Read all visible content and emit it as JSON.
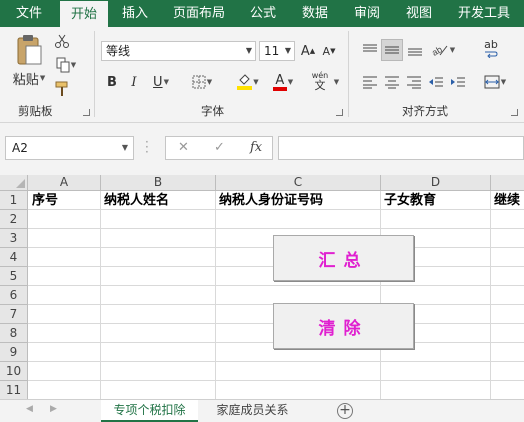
{
  "ribbon_tabs": [
    "文件",
    "开始",
    "插入",
    "页面布局",
    "公式",
    "数据",
    "审阅",
    "视图",
    "开发工具"
  ],
  "active_tab": "开始",
  "clipboard": {
    "paste_label": "粘贴",
    "group_label": "剪贴板",
    "icons": [
      "paste-icon",
      "cut-icon",
      "copy-icon",
      "format-painter-icon"
    ]
  },
  "font": {
    "font_name": "等线",
    "font_size": "11",
    "bold": "B",
    "italic": "I",
    "underline": "U",
    "font_color_glyph": "A",
    "fill_color": "#ffe100",
    "font_color": "#e00000",
    "pinyin_top": "wén",
    "pinyin_bottom": "文",
    "group_label": "字体"
  },
  "alignment": {
    "group_label": "对齐方式",
    "wrap_glyph": "ab",
    "icons": [
      "align-top-icon",
      "align-middle-icon",
      "align-bottom-icon",
      "orientation-icon",
      "align-left-icon",
      "align-center-icon",
      "align-right-icon",
      "decrease-indent-icon",
      "increase-indent-icon",
      "wrap-text-icon",
      "merge-center-icon"
    ]
  },
  "formula_bar": {
    "name_box": "A2",
    "cancel_glyph": "✕",
    "enter_glyph": "✓",
    "fx_label": "fx",
    "formula": ""
  },
  "columns": [
    "A",
    "B",
    "C",
    "D"
  ],
  "rows": [
    "1",
    "2",
    "3",
    "4",
    "5",
    "6",
    "7",
    "8",
    "9",
    "10",
    "11"
  ],
  "header_row": [
    "序号",
    "纳税人姓名",
    "纳税人身份证号码",
    "子女教育",
    "继续"
  ],
  "buttons": {
    "summary": "汇总",
    "clear": "清除",
    "text_color": "#e020d0"
  },
  "sheet_tabs": [
    "专项个税扣除",
    "家庭成员关系"
  ],
  "active_sheet": "专项个税扣除",
  "add_sheet_glyph": "+"
}
